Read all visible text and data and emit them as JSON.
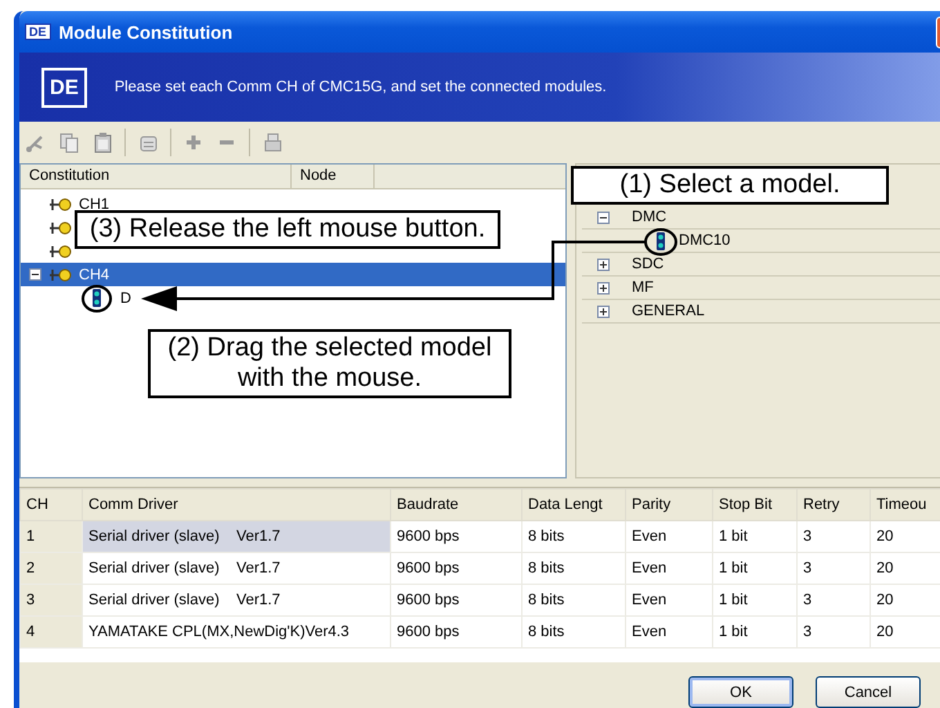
{
  "window": {
    "title": "Module Constitution",
    "logo": "DE"
  },
  "banner": {
    "logo": "DE",
    "message": "Please set each Comm CH of CMC15G, and set the connected modules."
  },
  "constitution_tree": {
    "columns": [
      "Constitution",
      "Node"
    ],
    "items": [
      {
        "label": "CH1",
        "selected": false
      },
      {
        "selected": false
      },
      {
        "selected": false
      },
      {
        "label": "CH4",
        "selected": true,
        "children": [
          {
            "label": "D",
            "selected": false
          }
        ]
      }
    ]
  },
  "model_tree": {
    "items": [
      {
        "label": "DMC",
        "expanded": true,
        "children": [
          {
            "label": "DMC10"
          }
        ]
      },
      {
        "label": "SDC",
        "expanded": false
      },
      {
        "label": "MF",
        "expanded": false
      },
      {
        "label": "GENERAL",
        "expanded": false
      }
    ]
  },
  "table": {
    "columns": [
      "CH",
      "Comm Driver",
      "Baudrate",
      "Data Lengt",
      "Parity",
      "Stop Bit",
      "Retry",
      "Timeou"
    ],
    "rows": [
      {
        "selected": true,
        "cells": [
          "1",
          "Serial driver (slave)    Ver1.7",
          "9600 bps",
          "8 bits",
          "Even",
          "1 bit",
          "3",
          "20"
        ]
      },
      {
        "selected": false,
        "cells": [
          "2",
          "Serial driver (slave)    Ver1.7",
          "9600 bps",
          "8 bits",
          "Even",
          "1 bit",
          "3",
          "20"
        ]
      },
      {
        "selected": false,
        "cells": [
          "3",
          "Serial driver (slave)    Ver1.7",
          "9600 bps",
          "8 bits",
          "Even",
          "1 bit",
          "3",
          "20"
        ]
      },
      {
        "selected": false,
        "cells": [
          "4",
          "YAMATAKE CPL(MX,NewDig'K)Ver4.3",
          "9600 bps",
          "8 bits",
          "Even",
          "1 bit",
          "3",
          "20"
        ]
      }
    ]
  },
  "buttons": [
    {
      "label": "OK",
      "default": true
    },
    {
      "label": "Cancel",
      "default": false
    }
  ],
  "callouts": [
    {
      "text": "(1) Select a model."
    },
    {
      "text": "(3) Release the left mouse button."
    },
    {
      "text": "(2) Drag the selected model\nwith the mouse."
    }
  ]
}
